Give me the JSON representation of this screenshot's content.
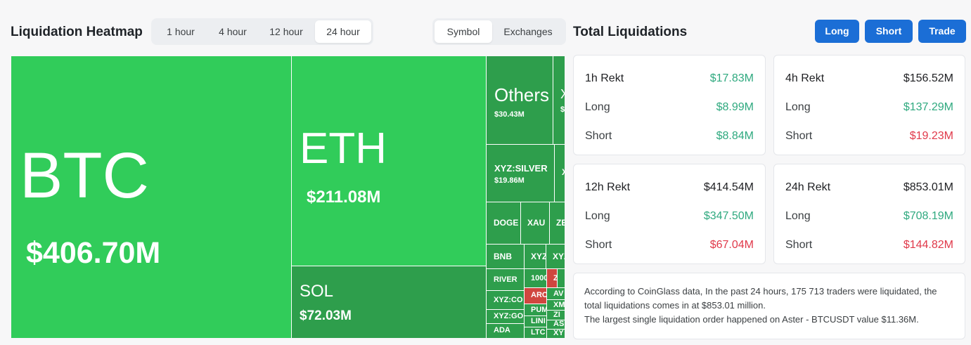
{
  "heatmap": {
    "title": "Liquidation Heatmap",
    "time_options": [
      "1 hour",
      "4 hour",
      "12 hour",
      "24 hour"
    ],
    "time_selected": "24 hour",
    "view_options": [
      "Symbol",
      "Exchanges"
    ],
    "view_selected": "Symbol",
    "cells": {
      "btc": {
        "symbol": "BTC",
        "value": "$406.70M"
      },
      "eth": {
        "symbol": "ETH",
        "value": "$211.08M"
      },
      "sol": {
        "symbol": "SOL",
        "value": "$72.03M"
      },
      "others": {
        "symbol": "Others",
        "value": "$30.43M"
      },
      "xyz_silver": {
        "symbol": "XYZ:SILVER",
        "value": "$19.86M"
      },
      "doge": {
        "symbol": "DOGE"
      },
      "xau": {
        "symbol": "XAU"
      },
      "ze": {
        "symbol": "ZE"
      },
      "bnb": {
        "symbol": "BNB"
      },
      "xyz_a": {
        "symbol": "XYZ"
      },
      "xyz_b": {
        "symbol": "XYZ"
      },
      "river": {
        "symbol": "RIVER"
      },
      "k1000": {
        "symbol": "1000"
      },
      "z_red": {
        "symbol": "Z"
      },
      "xyz_co": {
        "symbol": "XYZ:CO"
      },
      "arc": {
        "symbol": "ARC"
      },
      "av": {
        "symbol": "AV"
      },
      "xm": {
        "symbol": "XM"
      },
      "pum": {
        "symbol": "PUM"
      },
      "xyz_go": {
        "symbol": "XYZ:GO"
      },
      "zi": {
        "symbol": "ZI"
      },
      "lin": {
        "symbol": "LINI"
      },
      "as": {
        "symbol": "AS"
      },
      "ada": {
        "symbol": "ADA"
      },
      "ltc": {
        "symbol": "LTC"
      },
      "xy": {
        "symbol": "XY"
      },
      "x1": {
        "symbol": "X",
        "value": "$"
      },
      "x2": {
        "symbol": "X"
      }
    }
  },
  "totals": {
    "title": "Total Liquidations",
    "buttons": [
      "Long",
      "Short",
      "Trade"
    ],
    "cards": [
      {
        "period": "1h Rekt",
        "total": "$17.83M",
        "long_label": "Long",
        "long": "$8.99M",
        "short_label": "Short",
        "short": "$8.84M"
      },
      {
        "period": "4h Rekt",
        "total": "$156.52M",
        "long_label": "Long",
        "long": "$137.29M",
        "short_label": "Short",
        "short": "$19.23M"
      },
      {
        "period": "12h Rekt",
        "total": "$414.54M",
        "long_label": "Long",
        "long": "$347.50M",
        "short_label": "Short",
        "short": "$67.04M"
      },
      {
        "period": "24h Rekt",
        "total": "$853.01M",
        "long_label": "Long",
        "long": "$708.19M",
        "short_label": "Short",
        "short": "$144.82M"
      }
    ],
    "info_lines": [
      "According to CoinGlass data, In the past 24 hours, 175 713 traders were liquidated, the",
      "total liquidations comes in at $853.01 million.",
      "The largest single liquidation order happened on Aster - BTCUSDT value $11.36M."
    ]
  },
  "colors": {
    "bright_green": "#31cc5a",
    "dark_green": "#2e9e4c",
    "red_cell": "#d0463f",
    "accent_blue": "#1b6ed6",
    "positive_text": "#2fa97f",
    "negative_text": "#e0394a"
  }
}
